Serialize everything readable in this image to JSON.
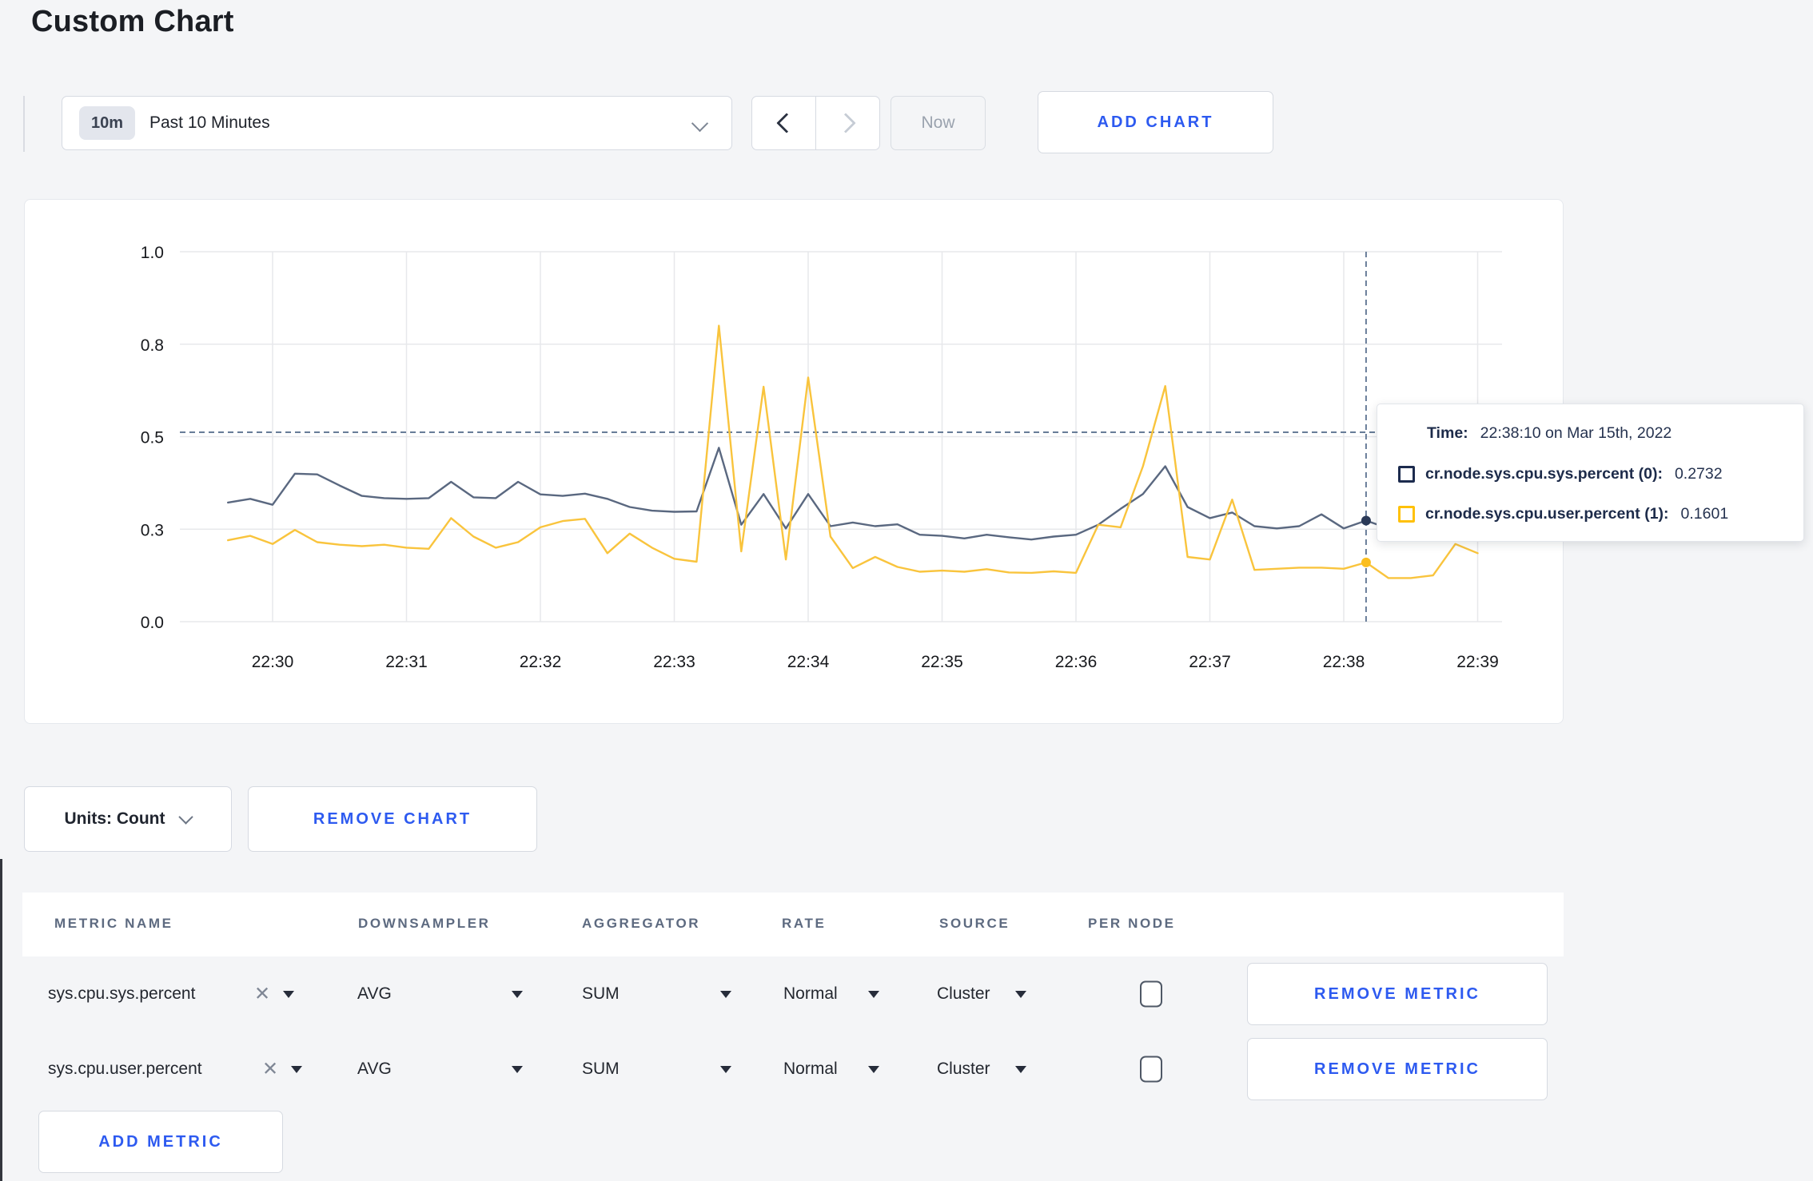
{
  "page": {
    "title": "Custom Chart"
  },
  "colors": {
    "accent_blue": "#2d5af0",
    "page_bg": "#f4f5f7",
    "grid": "#e7e8eb",
    "crosshair": "#5c7390"
  },
  "toolbar": {
    "time_range": {
      "badge": "10m",
      "label": "Past 10 Minutes"
    },
    "prev_icon": "chevron-left",
    "next_icon": "chevron-right",
    "now_label": "Now",
    "add_chart_label": "ADD CHART"
  },
  "tooltip": {
    "time_label": "Time:",
    "time_value": "22:38:10 on Mar 15th, 2022",
    "series": [
      {
        "label": "cr.node.sys.cpu.sys.percent (0):",
        "value": "0.2732"
      },
      {
        "label": "cr.node.sys.cpu.user.percent (1):",
        "value": "0.1601"
      }
    ]
  },
  "chart_data": {
    "type": "line",
    "title": "",
    "xlabel": "",
    "ylabel": "",
    "ylim": [
      0,
      1
    ],
    "grid": true,
    "x_start_time": "22:29:40",
    "interval_sec": 10,
    "y_ticks": [
      {
        "label": "0.0",
        "value": 0
      },
      {
        "label": "0.3",
        "value": 0.25
      },
      {
        "label": "0.5",
        "value": 0.5
      },
      {
        "label": "0.8",
        "value": 0.75
      },
      {
        "label": "1.0",
        "value": 1
      }
    ],
    "x_ticks": [
      "22:30",
      "22:31",
      "22:32",
      "22:33",
      "22:34",
      "22:35",
      "22:36",
      "22:37",
      "22:38",
      "22:39"
    ],
    "crosshair": {
      "time": "22:38:10",
      "time_sec_offset": 510,
      "hline_value": 0.512,
      "points": [
        {
          "series": 0,
          "value": 0.2732
        },
        {
          "series": 1,
          "value": 0.1601
        }
      ]
    },
    "series": [
      {
        "name": "cr.node.sys.cpu.sys.percent (0)",
        "color": "#5a6880",
        "color_dot": "#2b3a58",
        "color_swatch": "#1c2b4e",
        "values": [
          0.322,
          0.332,
          0.316,
          0.4,
          0.398,
          0.368,
          0.34,
          0.334,
          0.332,
          0.334,
          0.378,
          0.336,
          0.334,
          0.378,
          0.344,
          0.34,
          0.346,
          0.332,
          0.31,
          0.3,
          0.297,
          0.298,
          0.47,
          0.262,
          0.345,
          0.252,
          0.345,
          0.258,
          0.268,
          0.258,
          0.263,
          0.235,
          0.232,
          0.225,
          0.235,
          0.228,
          0.222,
          0.23,
          0.235,
          0.262,
          0.305,
          0.345,
          0.42,
          0.31,
          0.28,
          0.295,
          0.258,
          0.252,
          0.258,
          0.29,
          0.252,
          0.2732,
          0.252,
          0.248,
          0.25,
          0.252,
          0.248
        ]
      },
      {
        "name": "cr.node.sys.cpu.user.percent (1)",
        "color": "#f9c43d",
        "color_dot": "#fbbe1e",
        "color_swatch": "#ffc10a",
        "values": [
          0.22,
          0.232,
          0.21,
          0.248,
          0.215,
          0.208,
          0.204,
          0.208,
          0.2,
          0.197,
          0.28,
          0.23,
          0.2,
          0.215,
          0.255,
          0.272,
          0.278,
          0.185,
          0.238,
          0.2,
          0.17,
          0.162,
          0.8,
          0.19,
          0.635,
          0.168,
          0.66,
          0.23,
          0.145,
          0.175,
          0.148,
          0.135,
          0.138,
          0.135,
          0.142,
          0.133,
          0.132,
          0.136,
          0.132,
          0.262,
          0.255,
          0.42,
          0.637,
          0.175,
          0.168,
          0.33,
          0.14,
          0.143,
          0.146,
          0.146,
          0.143,
          0.1601,
          0.118,
          0.118,
          0.125,
          0.21,
          0.185
        ]
      }
    ]
  },
  "chart_footer": {
    "units_label": "Units: Count",
    "remove_chart_label": "REMOVE CHART"
  },
  "metrics_table": {
    "columns": [
      "METRIC NAME",
      "DOWNSAMPLER",
      "AGGREGATOR",
      "RATE",
      "SOURCE",
      "PER NODE"
    ],
    "rows": [
      {
        "metric_name": "sys.cpu.sys.percent",
        "downsampler": "AVG",
        "aggregator": "SUM",
        "rate": "Normal",
        "source": "Cluster",
        "per_node_checked": false,
        "remove_label": "REMOVE METRIC"
      },
      {
        "metric_name": "sys.cpu.user.percent",
        "downsampler": "AVG",
        "aggregator": "SUM",
        "rate": "Normal",
        "source": "Cluster",
        "per_node_checked": false,
        "remove_label": "REMOVE METRIC"
      }
    ],
    "add_metric_label": "ADD METRIC"
  }
}
